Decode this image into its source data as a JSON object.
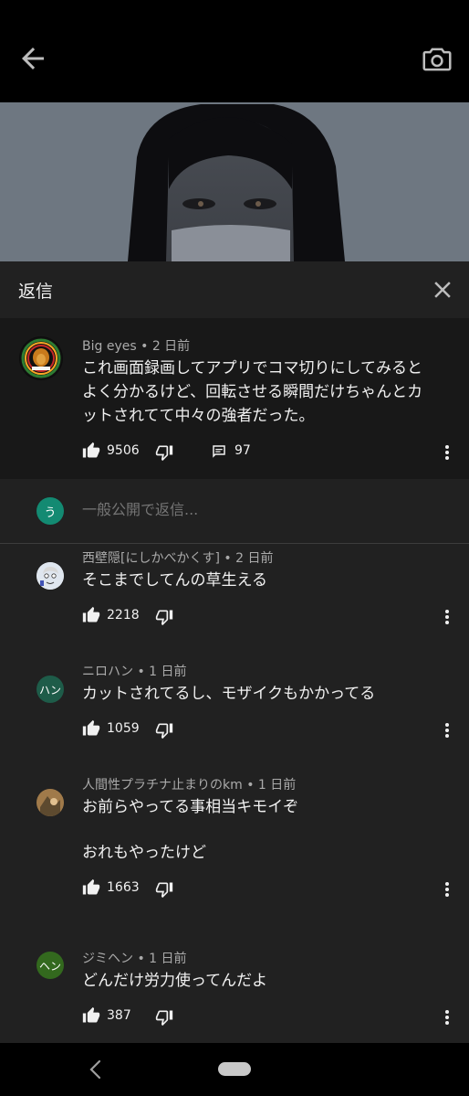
{
  "panel": {
    "title": "返信"
  },
  "parent": {
    "author": "Big eyes",
    "time": "2 日前",
    "lines": [
      "これ画面録画してアプリでコマ切りにしてみると",
      "よく分かるけど、回転させる瞬間だけちゃんとカ",
      "ットされてて中々の強者だった。"
    ],
    "likes": "9506",
    "replies": "97"
  },
  "reply_box": {
    "avatar_letter": "う",
    "avatar_color": "#138a72",
    "placeholder": "一般公開で返信..."
  },
  "replies": [
    {
      "author": "西壁隠[にしかべかくす]",
      "time": "2 日前",
      "lines": [
        "そこまでしてんの草生える"
      ],
      "likes": "2218"
    },
    {
      "author": "ニロハン",
      "time": "1 日前",
      "avatar_letter": "ハン",
      "avatar_color": "#1e5c49",
      "lines": [
        "カットされてるし、モザイクもかかってる"
      ],
      "likes": "1059"
    },
    {
      "author": "人間性プラチナ止まりのkm",
      "time": "1 日前",
      "lines": [
        "お前らやってる事相当キモイぞ",
        "",
        "おれもやったけど"
      ],
      "likes": "1663"
    },
    {
      "author": "ジミヘン",
      "time": "1 日前",
      "avatar_letter": "ヘン",
      "avatar_color": "#33691e",
      "lines": [
        "どんだけ労力使ってんだよ"
      ],
      "likes": "387"
    }
  ],
  "icons": {
    "back": "arrow-left-icon",
    "camera": "camera-icon",
    "close": "close-icon",
    "like": "thumb-up-icon",
    "dislike": "thumb-down-icon",
    "comment": "comment-icon",
    "more": "more-vert-icon"
  }
}
